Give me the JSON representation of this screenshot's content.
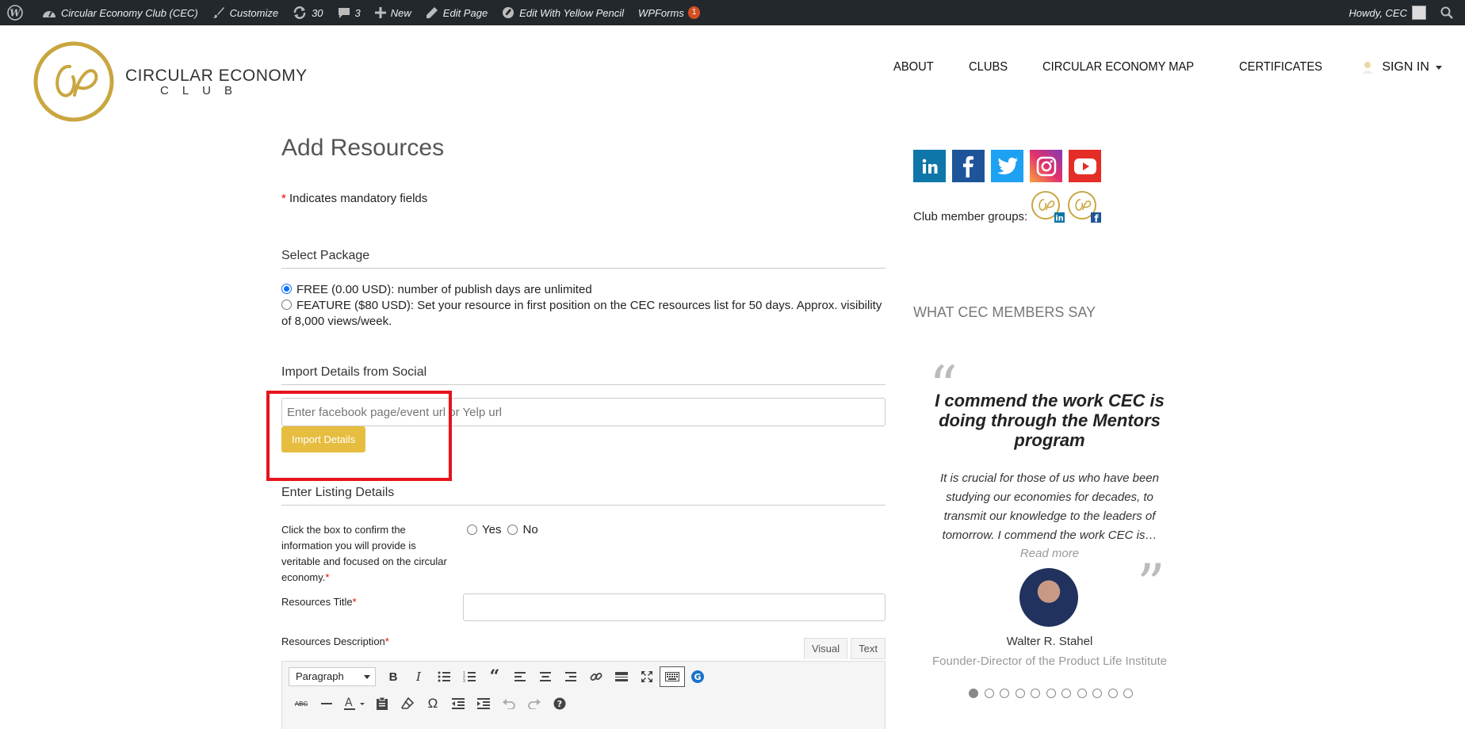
{
  "adminbar": {
    "site_name": "Circular Economy Club (CEC)",
    "customize": "Customize",
    "updates_count": "30",
    "comments_count": "3",
    "new": "New",
    "edit_page": "Edit Page",
    "yellow_pencil": "Edit With Yellow Pencil",
    "wpforms": "WPForms",
    "wpforms_badge": "1",
    "howdy": "Howdy, CEC"
  },
  "logo": {
    "line1": "CIRCULAR ECONOMY",
    "line2": "CLUB"
  },
  "nav": {
    "items": [
      "ABOUT",
      "CLUBS",
      "CIRCULAR ECONOMY MAP",
      "CERTIFICATES"
    ],
    "signin": "SIGN IN"
  },
  "form": {
    "title": "Add Resources",
    "mandatory_note": "Indicates mandatory fields",
    "mandatory_star": "*",
    "select_package": "Select Package",
    "package_free": "FREE (0.00 USD): number of publish days are unlimited",
    "package_feature": "FEATURE ($80 USD): Set your resource in first position on the CEC resources list for 50 days. Approx. visibility of 8,000 views/week.",
    "import_social": "Import Details from Social",
    "import_placeholder": "Enter facebook page/event url or Yelp url",
    "import_button": "Import Details",
    "listing_details": "Enter Listing Details",
    "confirm_label": "Click the box to confirm the information you will provide is veritable and focused on the circular economy.",
    "yes": "Yes",
    "no": "No",
    "resources_title": "Resources Title",
    "resources_description": "Resources Description",
    "tab_visual": "Visual",
    "tab_text": "Text",
    "paragraph": "Paragraph"
  },
  "sidebar": {
    "social": [
      "linkedin",
      "facebook",
      "twitter",
      "instagram",
      "youtube"
    ],
    "groups_label": "Club member groups:",
    "testimonial_heading": "WHAT CEC MEMBERS SAY",
    "testimonial_title": "I commend the work CEC is doing through the Mentors program",
    "testimonial_body": "It is crucial for those of us who have been studying our economies for decades, to transmit our knowledge to the leaders of tomorrow. I commend the work CEC is…",
    "read_more": "Read more",
    "person_name": "Walter R. Stahel",
    "person_role": "Founder-Director of the Product Life Institute",
    "dots_total": 11,
    "dots_active": 0
  },
  "colors": {
    "accent_gold": "#e6bd3e",
    "admin_bar": "#23282d",
    "highlight_red": "#e8131b"
  }
}
